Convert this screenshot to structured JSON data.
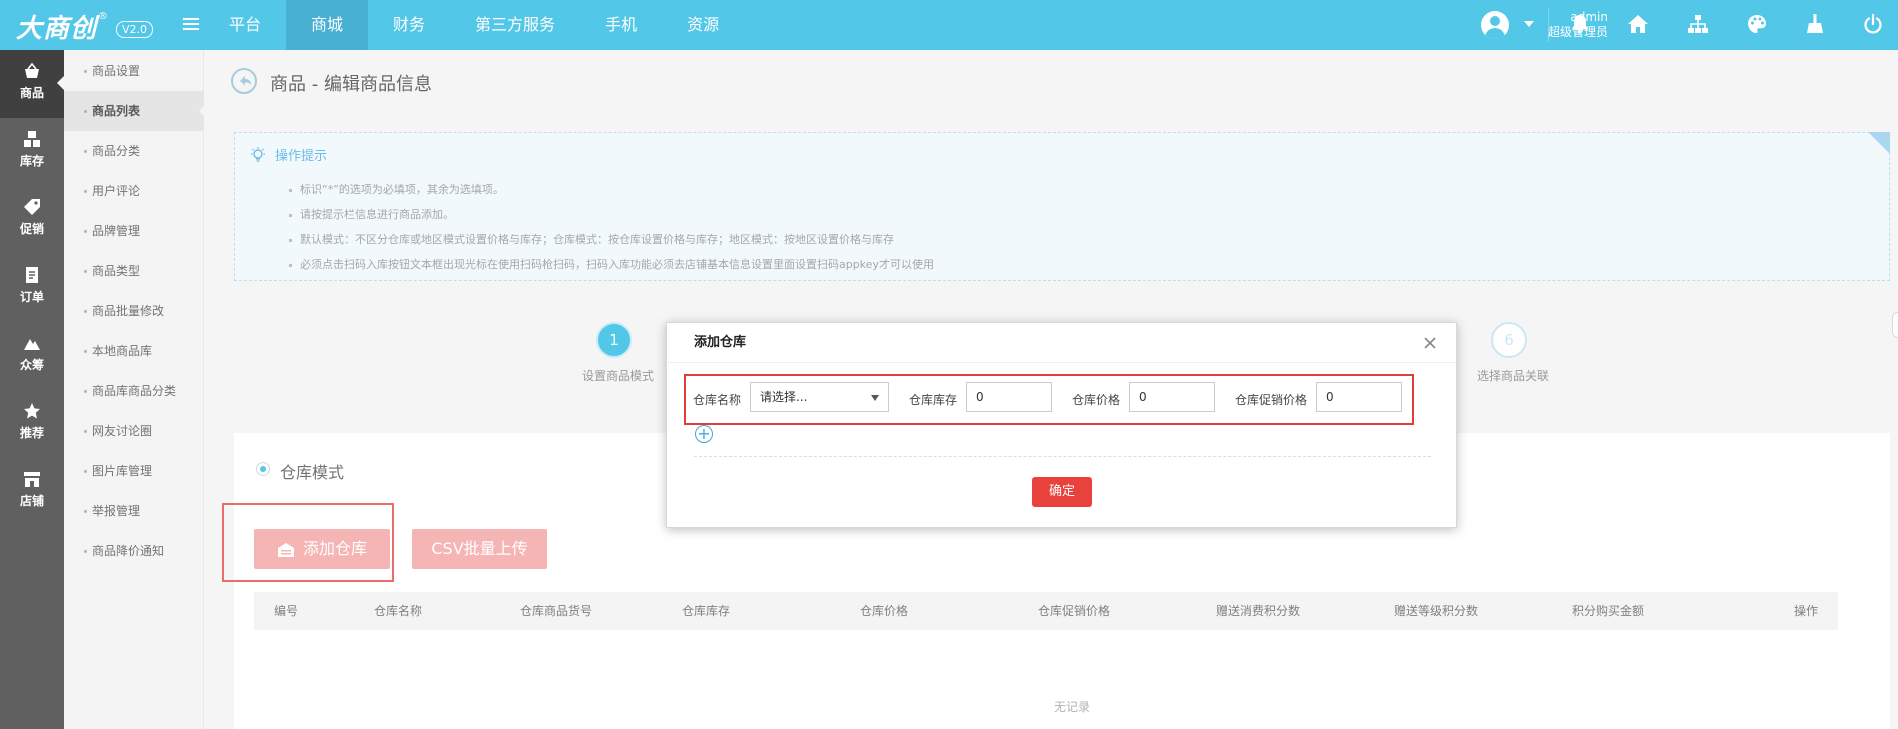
{
  "brand": {
    "logo": "大商创",
    "reg": "®",
    "version": "V2.0"
  },
  "topnav": [
    "平台",
    "商城",
    "财务",
    "第三方服务",
    "手机",
    "资源"
  ],
  "user": {
    "name": "admin",
    "role": "超级管理员"
  },
  "left_menu": [
    "商品",
    "库存",
    "促销",
    "订单",
    "众筹",
    "推荐",
    "店铺"
  ],
  "sub_menu": [
    "商品设置",
    "商品列表",
    "商品分类",
    "用户评论",
    "品牌管理",
    "商品类型",
    "商品批量修改",
    "本地商品库",
    "商品库商品分类",
    "网友讨论圈",
    "图片库管理",
    "举报管理",
    "商品降价通知"
  ],
  "page": {
    "title": "商品 - 编辑商品信息"
  },
  "tips": {
    "title": "操作提示",
    "items": [
      "标识“*”的选项为必填项，其余为选填项。",
      "请按提示栏信息进行商品添加。",
      "默认模式：不区分仓库或地区模式设置价格与库存；仓库模式：按仓库设置价格与库存；地区模式：按地区设置价格与库存",
      "必须点击扫码入库按钮文本框出现光标在使用扫码枪扫码，扫码入库功能必须去店铺基本信息设置里面设置扫码appkey才可以使用"
    ]
  },
  "steps": {
    "step1": {
      "num": "1",
      "label": "设置商品模式"
    },
    "step6": {
      "num": "6",
      "label": "选择商品关联"
    }
  },
  "mode": {
    "label": "仓库模式"
  },
  "buttons": {
    "add_warehouse": "添加仓库",
    "csv_upload": "CSV批量上传"
  },
  "table": {
    "columns": [
      "编号",
      "仓库名称",
      "仓库商品货号",
      "仓库库存",
      "仓库价格",
      "仓库促销价格",
      "赠送消费积分数",
      "赠送等级积分数",
      "积分购买金额",
      "操作"
    ],
    "empty": "无记录"
  },
  "dialog": {
    "title": "添加仓库",
    "fields": {
      "name_label": "仓库名称",
      "name_value": "请选择...",
      "stock_label": "仓库库存",
      "stock_value": "0",
      "price_label": "仓库价格",
      "price_value": "0",
      "promo_label": "仓库促销价格",
      "promo_value": "0"
    },
    "add_symbol": "+",
    "confirm": "确定"
  }
}
